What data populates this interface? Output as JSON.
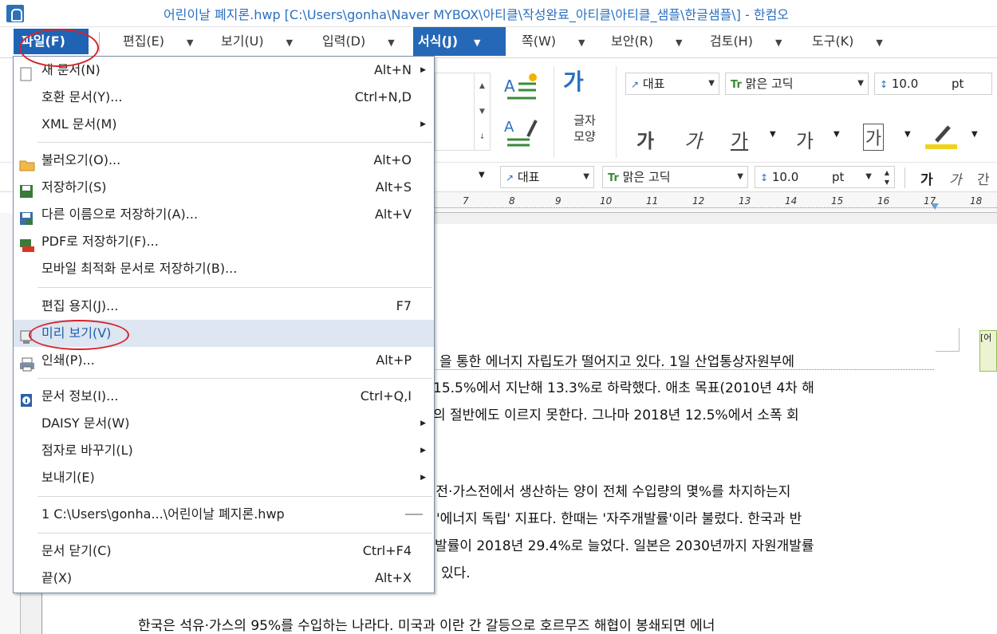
{
  "window": {
    "title": "어린이날 폐지론.hwp [C:\\Users\\gonha\\Naver MYBOX\\아티클\\작성완료_아티클\\아티클_샘플\\한글샘플\\] - 한컴오"
  },
  "menubar": {
    "items": [
      {
        "label": "파일(F)"
      },
      {
        "label": "편집(E)"
      },
      {
        "label": "보기(U)"
      },
      {
        "label": "입력(D)"
      },
      {
        "label": "서식(J)"
      },
      {
        "label": "쪽(W)"
      },
      {
        "label": "보안(R)"
      },
      {
        "label": "검토(H)"
      },
      {
        "label": "도구(K)"
      }
    ],
    "arrow": "▼"
  },
  "ribbon": {
    "char_shape_label": "글자\n모양",
    "style_value": "대표",
    "font_value": "맑은 고딕",
    "size_value": "10.0",
    "size_unit": "pt",
    "bold": "가",
    "italic": "가",
    "underline": "가",
    "strike": "가",
    "outline": "가"
  },
  "toolbar2": {
    "style_value": "대표",
    "font_value": "맑은 고딕",
    "size_value": "10.0",
    "size_unit": "pt",
    "bold": "가",
    "italic": "가",
    "underline": "간"
  },
  "ruler": {
    "numbers": [
      "7",
      "8",
      "9",
      "10",
      "11",
      "12",
      "13",
      "14",
      "15",
      "16",
      "17",
      "18"
    ]
  },
  "document": {
    "lines": [
      "을 통한 에너지 자립도가 떨어지고 있다. 1일 산업통상자원부에",
      "15.5%에서 지난해 13.3%로 하락했다. 애초 목표(2010년 4차 해",
      "의 절반에도 이르지 못한다. 그나마 2018년 12.5%에서 소폭 회",
      "·전·가스전에서 생산하는 양이 전체 수입량의 몇%를 차지하는지",
      "'에너지 독립' 지표다. 한때는 '자주개발률'이라 불렀다. 한국과 반",
      "발률이 2018년 29.4%로 늘었다. 일본은 2030년까지 자원개발률",
      "있다.",
      "한국은 석유·가스의 95%를 수입하는 나라다. 미국과 이란 간 갈등으로 호르무즈 해협이 봉쇄되면 에너"
    ],
    "note_tab": "[어"
  },
  "file_menu": {
    "items": [
      {
        "label": "새 문서(N)",
        "shortcut": "Alt+N",
        "submenu": true,
        "icon": "new-doc-icon"
      },
      {
        "label": "호환 문서(Y)...",
        "shortcut": "Ctrl+N,D",
        "submenu": false,
        "icon": ""
      },
      {
        "label": "XML 문서(M)",
        "shortcut": "",
        "submenu": true,
        "icon": ""
      },
      {
        "label": "불러오기(O)...",
        "shortcut": "Alt+O",
        "submenu": false,
        "icon": "folder-icon"
      },
      {
        "label": "저장하기(S)",
        "shortcut": "Alt+S",
        "submenu": false,
        "icon": "save-icon"
      },
      {
        "label": "다른 이름으로 저장하기(A)...",
        "shortcut": "Alt+V",
        "submenu": false,
        "icon": "save-as-icon"
      },
      {
        "label": "PDF로 저장하기(F)...",
        "shortcut": "",
        "submenu": false,
        "icon": "pdf-icon"
      },
      {
        "label": "모바일 최적화 문서로 저장하기(B)...",
        "shortcut": "",
        "submenu": false,
        "icon": ""
      },
      {
        "label": "편집 용지(J)...",
        "shortcut": "F7",
        "submenu": false,
        "icon": ""
      },
      {
        "label": "미리 보기(V)",
        "shortcut": "",
        "submenu": false,
        "icon": "preview-icon"
      },
      {
        "label": "인쇄(P)...",
        "shortcut": "Alt+P",
        "submenu": false,
        "icon": "print-icon"
      },
      {
        "label": "문서 정보(I)...",
        "shortcut": "Ctrl+Q,I",
        "submenu": false,
        "icon": "info-icon"
      },
      {
        "label": "DAISY 문서(W)",
        "shortcut": "",
        "submenu": true,
        "icon": ""
      },
      {
        "label": "점자로 바꾸기(L)",
        "shortcut": "",
        "submenu": true,
        "icon": ""
      },
      {
        "label": "보내기(E)",
        "shortcut": "",
        "submenu": true,
        "icon": ""
      },
      {
        "label": "1 C:\\Users\\gonha...\\어린이날 폐지론.hwp",
        "shortcut": "",
        "submenu": false,
        "icon": ""
      },
      {
        "label": "문서 닫기(C)",
        "shortcut": "Ctrl+F4",
        "submenu": false,
        "icon": ""
      },
      {
        "label": "끝(X)",
        "shortcut": "Alt+X",
        "submenu": false,
        "icon": ""
      }
    ],
    "highlighted_index": 9
  },
  "colors": {
    "accent": "#1f63b4",
    "highlight": "#dde6f1",
    "annotation": "#d7232b"
  }
}
